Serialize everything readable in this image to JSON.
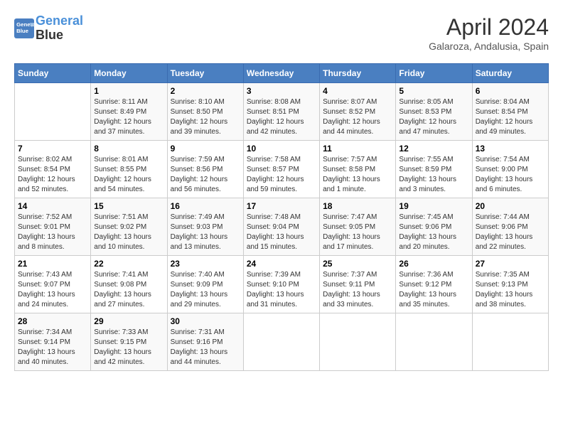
{
  "header": {
    "logo_line1": "General",
    "logo_line2": "Blue",
    "month_title": "April 2024",
    "subtitle": "Galaroza, Andalusia, Spain"
  },
  "days_of_week": [
    "Sunday",
    "Monday",
    "Tuesday",
    "Wednesday",
    "Thursday",
    "Friday",
    "Saturday"
  ],
  "weeks": [
    [
      {
        "day": "",
        "info": ""
      },
      {
        "day": "1",
        "info": "Sunrise: 8:11 AM\nSunset: 8:49 PM\nDaylight: 12 hours\nand 37 minutes."
      },
      {
        "day": "2",
        "info": "Sunrise: 8:10 AM\nSunset: 8:50 PM\nDaylight: 12 hours\nand 39 minutes."
      },
      {
        "day": "3",
        "info": "Sunrise: 8:08 AM\nSunset: 8:51 PM\nDaylight: 12 hours\nand 42 minutes."
      },
      {
        "day": "4",
        "info": "Sunrise: 8:07 AM\nSunset: 8:52 PM\nDaylight: 12 hours\nand 44 minutes."
      },
      {
        "day": "5",
        "info": "Sunrise: 8:05 AM\nSunset: 8:53 PM\nDaylight: 12 hours\nand 47 minutes."
      },
      {
        "day": "6",
        "info": "Sunrise: 8:04 AM\nSunset: 8:54 PM\nDaylight: 12 hours\nand 49 minutes."
      }
    ],
    [
      {
        "day": "7",
        "info": "Sunrise: 8:02 AM\nSunset: 8:54 PM\nDaylight: 12 hours\nand 52 minutes."
      },
      {
        "day": "8",
        "info": "Sunrise: 8:01 AM\nSunset: 8:55 PM\nDaylight: 12 hours\nand 54 minutes."
      },
      {
        "day": "9",
        "info": "Sunrise: 7:59 AM\nSunset: 8:56 PM\nDaylight: 12 hours\nand 56 minutes."
      },
      {
        "day": "10",
        "info": "Sunrise: 7:58 AM\nSunset: 8:57 PM\nDaylight: 12 hours\nand 59 minutes."
      },
      {
        "day": "11",
        "info": "Sunrise: 7:57 AM\nSunset: 8:58 PM\nDaylight: 13 hours\nand 1 minute."
      },
      {
        "day": "12",
        "info": "Sunrise: 7:55 AM\nSunset: 8:59 PM\nDaylight: 13 hours\nand 3 minutes."
      },
      {
        "day": "13",
        "info": "Sunrise: 7:54 AM\nSunset: 9:00 PM\nDaylight: 13 hours\nand 6 minutes."
      }
    ],
    [
      {
        "day": "14",
        "info": "Sunrise: 7:52 AM\nSunset: 9:01 PM\nDaylight: 13 hours\nand 8 minutes."
      },
      {
        "day": "15",
        "info": "Sunrise: 7:51 AM\nSunset: 9:02 PM\nDaylight: 13 hours\nand 10 minutes."
      },
      {
        "day": "16",
        "info": "Sunrise: 7:49 AM\nSunset: 9:03 PM\nDaylight: 13 hours\nand 13 minutes."
      },
      {
        "day": "17",
        "info": "Sunrise: 7:48 AM\nSunset: 9:04 PM\nDaylight: 13 hours\nand 15 minutes."
      },
      {
        "day": "18",
        "info": "Sunrise: 7:47 AM\nSunset: 9:05 PM\nDaylight: 13 hours\nand 17 minutes."
      },
      {
        "day": "19",
        "info": "Sunrise: 7:45 AM\nSunset: 9:06 PM\nDaylight: 13 hours\nand 20 minutes."
      },
      {
        "day": "20",
        "info": "Sunrise: 7:44 AM\nSunset: 9:06 PM\nDaylight: 13 hours\nand 22 minutes."
      }
    ],
    [
      {
        "day": "21",
        "info": "Sunrise: 7:43 AM\nSunset: 9:07 PM\nDaylight: 13 hours\nand 24 minutes."
      },
      {
        "day": "22",
        "info": "Sunrise: 7:41 AM\nSunset: 9:08 PM\nDaylight: 13 hours\nand 27 minutes."
      },
      {
        "day": "23",
        "info": "Sunrise: 7:40 AM\nSunset: 9:09 PM\nDaylight: 13 hours\nand 29 minutes."
      },
      {
        "day": "24",
        "info": "Sunrise: 7:39 AM\nSunset: 9:10 PM\nDaylight: 13 hours\nand 31 minutes."
      },
      {
        "day": "25",
        "info": "Sunrise: 7:37 AM\nSunset: 9:11 PM\nDaylight: 13 hours\nand 33 minutes."
      },
      {
        "day": "26",
        "info": "Sunrise: 7:36 AM\nSunset: 9:12 PM\nDaylight: 13 hours\nand 35 minutes."
      },
      {
        "day": "27",
        "info": "Sunrise: 7:35 AM\nSunset: 9:13 PM\nDaylight: 13 hours\nand 38 minutes."
      }
    ],
    [
      {
        "day": "28",
        "info": "Sunrise: 7:34 AM\nSunset: 9:14 PM\nDaylight: 13 hours\nand 40 minutes."
      },
      {
        "day": "29",
        "info": "Sunrise: 7:33 AM\nSunset: 9:15 PM\nDaylight: 13 hours\nand 42 minutes."
      },
      {
        "day": "30",
        "info": "Sunrise: 7:31 AM\nSunset: 9:16 PM\nDaylight: 13 hours\nand 44 minutes."
      },
      {
        "day": "",
        "info": ""
      },
      {
        "day": "",
        "info": ""
      },
      {
        "day": "",
        "info": ""
      },
      {
        "day": "",
        "info": ""
      }
    ]
  ]
}
